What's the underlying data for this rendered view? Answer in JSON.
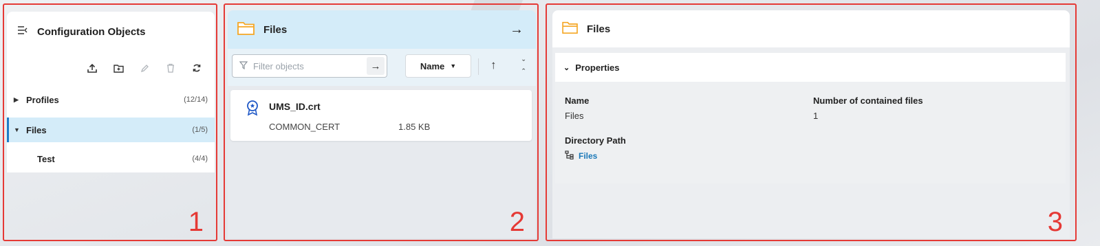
{
  "panel1": {
    "number_label": "1",
    "title": "Configuration Objects",
    "toolbar": [
      "upload-icon",
      "add-folder-icon",
      "edit-icon",
      "delete-icon",
      "refresh-icon"
    ],
    "tree": [
      {
        "label": "Profiles",
        "count": "(12/14)",
        "expanded": false,
        "selected": false
      },
      {
        "label": "Files",
        "count": "(1/5)",
        "expanded": true,
        "selected": true
      },
      {
        "label": "Test",
        "count": "(4/4)",
        "expanded": false,
        "selected": false
      }
    ]
  },
  "panel2": {
    "number_label": "2",
    "title": "Files",
    "filter_placeholder": "Filter objects",
    "sort_field": "Name",
    "items": [
      {
        "name": "UMS_ID.crt",
        "type": "COMMON_CERT",
        "size": "1.85 KB"
      }
    ]
  },
  "panel3": {
    "number_label": "3",
    "title": "Files",
    "section_title": "Properties",
    "props": {
      "name_label": "Name",
      "name_value": "Files",
      "count_label": "Number of contained files",
      "count_value": "1",
      "path_label": "Directory Path",
      "path_value": "Files"
    }
  },
  "colors": {
    "annotation_border": "#e53935",
    "selected_bg": "#d4ecf9",
    "accent_blue": "#1e7bc6",
    "folder_yellow": "#f5a623"
  }
}
